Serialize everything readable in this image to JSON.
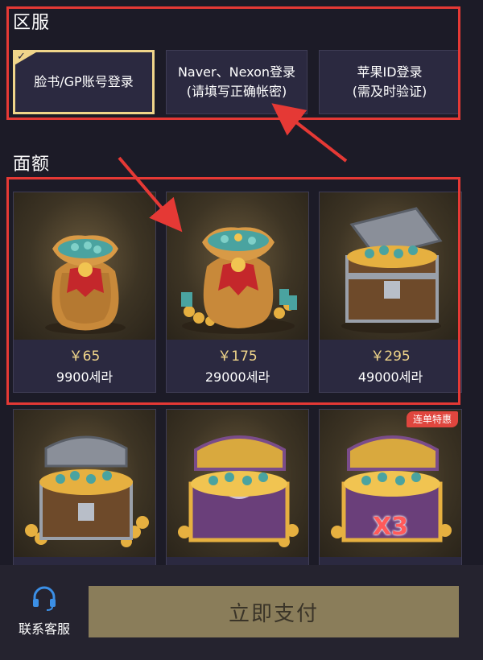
{
  "region": {
    "title": "区服",
    "options": [
      {
        "line1": "脸书/GP账号登录",
        "line2": "",
        "selected": true
      },
      {
        "line1": "Naver、Nexon登录",
        "line2": "(请填写正确帐密)",
        "selected": false
      },
      {
        "line1": "苹果ID登录",
        "line2": "(需及时验证)",
        "selected": false
      }
    ]
  },
  "amount": {
    "title": "面额",
    "cards": [
      {
        "price": "￥65",
        "amount": "9900세라",
        "art": "gold-bag-small"
      },
      {
        "price": "￥175",
        "amount": "29000세라",
        "art": "gold-bag-large"
      },
      {
        "price": "￥295",
        "amount": "49000세라",
        "art": "treasure-chest-silver"
      },
      {
        "art": "treasure-chest-silver-large"
      },
      {
        "art": "treasure-chest-gold"
      },
      {
        "art": "treasure-chest-gold-x3",
        "badge": "连单特惠",
        "multiplier": "X3"
      }
    ]
  },
  "bottom": {
    "service_label": "联系客服",
    "pay_label": "立即支付"
  },
  "colors": {
    "background": "#1c1b27",
    "card": "#2b2940",
    "gold": "#f0d58a",
    "highlight": "#e53935",
    "pay_button": "#8a7d5a",
    "badge": "#e0463e"
  },
  "icons": [
    "check-icon",
    "headset-icon",
    "annotation-arrow"
  ]
}
